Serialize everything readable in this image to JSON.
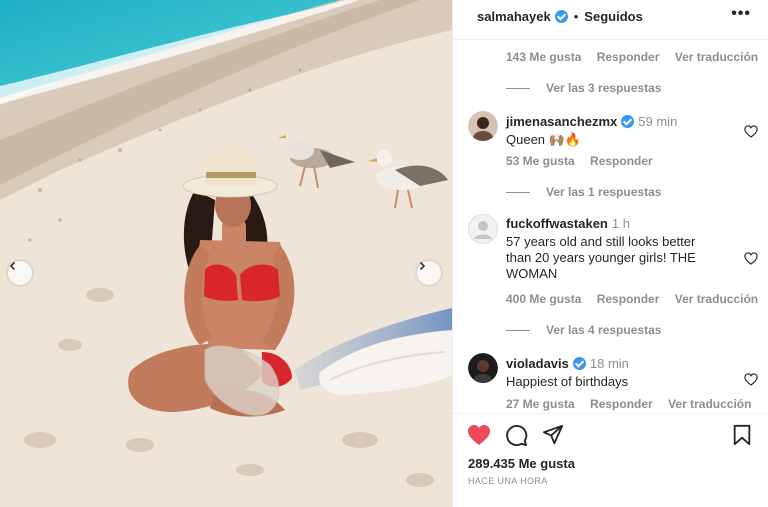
{
  "post": {
    "username": "salmahayek",
    "separator": "•",
    "follow_status": "Seguidos",
    "more_icon": "more-horizontal-icon",
    "likes": "289.435 Me gusta",
    "time_ago": "HACE UNA HORA"
  },
  "thread": {
    "top_meta": {
      "likes": "143 Me gusta",
      "reply": "Responder",
      "translate": "Ver traducción"
    },
    "top_replies": "Ver las 3 respuestas",
    "comments": [
      {
        "user": "jimenasanchezmx",
        "verified": true,
        "time": "59 min",
        "text": "Queen 🙌🏽🔥",
        "likes": "53 Me gusta",
        "reply": "Responder",
        "translate": "",
        "replies": "Ver las 1 respuestas"
      },
      {
        "user": "fuckoffwastaken",
        "verified": false,
        "time": "1 h",
        "text": "57 years old and still looks better than 20 years younger girls! THE WOMAN",
        "likes": "400 Me gusta",
        "reply": "Responder",
        "translate": "Ver traducción",
        "replies": "Ver las 4 respuestas"
      },
      {
        "user": "violadavis",
        "verified": true,
        "time": "18 min",
        "text": "Happiest of birthdays",
        "likes": "27 Me gusta",
        "reply": "Responder",
        "translate": "Ver traducción",
        "replies": ""
      }
    ]
  },
  "icons": {
    "like": "heart-filled-icon",
    "comment": "comment-icon",
    "share": "send-icon",
    "save": "bookmark-icon",
    "prev": "chevron-left-icon",
    "next": "chevron-right-icon"
  },
  "colors": {
    "accent_red": "#ed4956",
    "verified_blue": "#3897f0",
    "muted": "#8e8e8e",
    "text": "#262626"
  }
}
